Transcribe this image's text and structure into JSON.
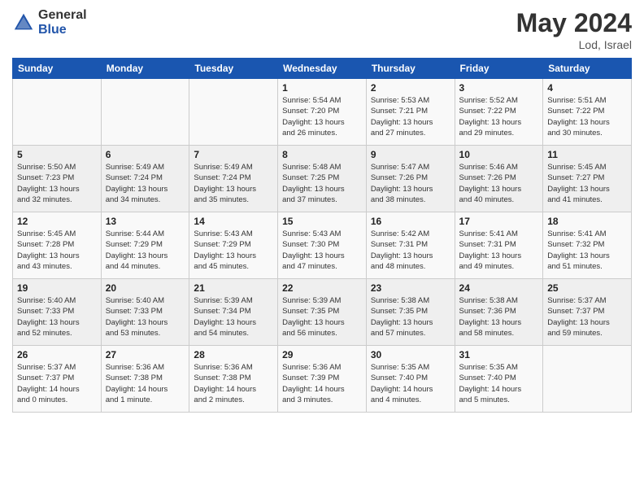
{
  "header": {
    "logo_general": "General",
    "logo_blue": "Blue",
    "month_year": "May 2024",
    "location": "Lod, Israel"
  },
  "weekdays": [
    "Sunday",
    "Monday",
    "Tuesday",
    "Wednesday",
    "Thursday",
    "Friday",
    "Saturday"
  ],
  "weeks": [
    [
      {
        "day": "",
        "info": ""
      },
      {
        "day": "",
        "info": ""
      },
      {
        "day": "",
        "info": ""
      },
      {
        "day": "1",
        "info": "Sunrise: 5:54 AM\nSunset: 7:20 PM\nDaylight: 13 hours\nand 26 minutes."
      },
      {
        "day": "2",
        "info": "Sunrise: 5:53 AM\nSunset: 7:21 PM\nDaylight: 13 hours\nand 27 minutes."
      },
      {
        "day": "3",
        "info": "Sunrise: 5:52 AM\nSunset: 7:22 PM\nDaylight: 13 hours\nand 29 minutes."
      },
      {
        "day": "4",
        "info": "Sunrise: 5:51 AM\nSunset: 7:22 PM\nDaylight: 13 hours\nand 30 minutes."
      }
    ],
    [
      {
        "day": "5",
        "info": "Sunrise: 5:50 AM\nSunset: 7:23 PM\nDaylight: 13 hours\nand 32 minutes."
      },
      {
        "day": "6",
        "info": "Sunrise: 5:49 AM\nSunset: 7:24 PM\nDaylight: 13 hours\nand 34 minutes."
      },
      {
        "day": "7",
        "info": "Sunrise: 5:49 AM\nSunset: 7:24 PM\nDaylight: 13 hours\nand 35 minutes."
      },
      {
        "day": "8",
        "info": "Sunrise: 5:48 AM\nSunset: 7:25 PM\nDaylight: 13 hours\nand 37 minutes."
      },
      {
        "day": "9",
        "info": "Sunrise: 5:47 AM\nSunset: 7:26 PM\nDaylight: 13 hours\nand 38 minutes."
      },
      {
        "day": "10",
        "info": "Sunrise: 5:46 AM\nSunset: 7:26 PM\nDaylight: 13 hours\nand 40 minutes."
      },
      {
        "day": "11",
        "info": "Sunrise: 5:45 AM\nSunset: 7:27 PM\nDaylight: 13 hours\nand 41 minutes."
      }
    ],
    [
      {
        "day": "12",
        "info": "Sunrise: 5:45 AM\nSunset: 7:28 PM\nDaylight: 13 hours\nand 43 minutes."
      },
      {
        "day": "13",
        "info": "Sunrise: 5:44 AM\nSunset: 7:29 PM\nDaylight: 13 hours\nand 44 minutes."
      },
      {
        "day": "14",
        "info": "Sunrise: 5:43 AM\nSunset: 7:29 PM\nDaylight: 13 hours\nand 45 minutes."
      },
      {
        "day": "15",
        "info": "Sunrise: 5:43 AM\nSunset: 7:30 PM\nDaylight: 13 hours\nand 47 minutes."
      },
      {
        "day": "16",
        "info": "Sunrise: 5:42 AM\nSunset: 7:31 PM\nDaylight: 13 hours\nand 48 minutes."
      },
      {
        "day": "17",
        "info": "Sunrise: 5:41 AM\nSunset: 7:31 PM\nDaylight: 13 hours\nand 49 minutes."
      },
      {
        "day": "18",
        "info": "Sunrise: 5:41 AM\nSunset: 7:32 PM\nDaylight: 13 hours\nand 51 minutes."
      }
    ],
    [
      {
        "day": "19",
        "info": "Sunrise: 5:40 AM\nSunset: 7:33 PM\nDaylight: 13 hours\nand 52 minutes."
      },
      {
        "day": "20",
        "info": "Sunrise: 5:40 AM\nSunset: 7:33 PM\nDaylight: 13 hours\nand 53 minutes."
      },
      {
        "day": "21",
        "info": "Sunrise: 5:39 AM\nSunset: 7:34 PM\nDaylight: 13 hours\nand 54 minutes."
      },
      {
        "day": "22",
        "info": "Sunrise: 5:39 AM\nSunset: 7:35 PM\nDaylight: 13 hours\nand 56 minutes."
      },
      {
        "day": "23",
        "info": "Sunrise: 5:38 AM\nSunset: 7:35 PM\nDaylight: 13 hours\nand 57 minutes."
      },
      {
        "day": "24",
        "info": "Sunrise: 5:38 AM\nSunset: 7:36 PM\nDaylight: 13 hours\nand 58 minutes."
      },
      {
        "day": "25",
        "info": "Sunrise: 5:37 AM\nSunset: 7:37 PM\nDaylight: 13 hours\nand 59 minutes."
      }
    ],
    [
      {
        "day": "26",
        "info": "Sunrise: 5:37 AM\nSunset: 7:37 PM\nDaylight: 14 hours\nand 0 minutes."
      },
      {
        "day": "27",
        "info": "Sunrise: 5:36 AM\nSunset: 7:38 PM\nDaylight: 14 hours\nand 1 minute."
      },
      {
        "day": "28",
        "info": "Sunrise: 5:36 AM\nSunset: 7:38 PM\nDaylight: 14 hours\nand 2 minutes."
      },
      {
        "day": "29",
        "info": "Sunrise: 5:36 AM\nSunset: 7:39 PM\nDaylight: 14 hours\nand 3 minutes."
      },
      {
        "day": "30",
        "info": "Sunrise: 5:35 AM\nSunset: 7:40 PM\nDaylight: 14 hours\nand 4 minutes."
      },
      {
        "day": "31",
        "info": "Sunrise: 5:35 AM\nSunset: 7:40 PM\nDaylight: 14 hours\nand 5 minutes."
      },
      {
        "day": "",
        "info": ""
      }
    ]
  ]
}
